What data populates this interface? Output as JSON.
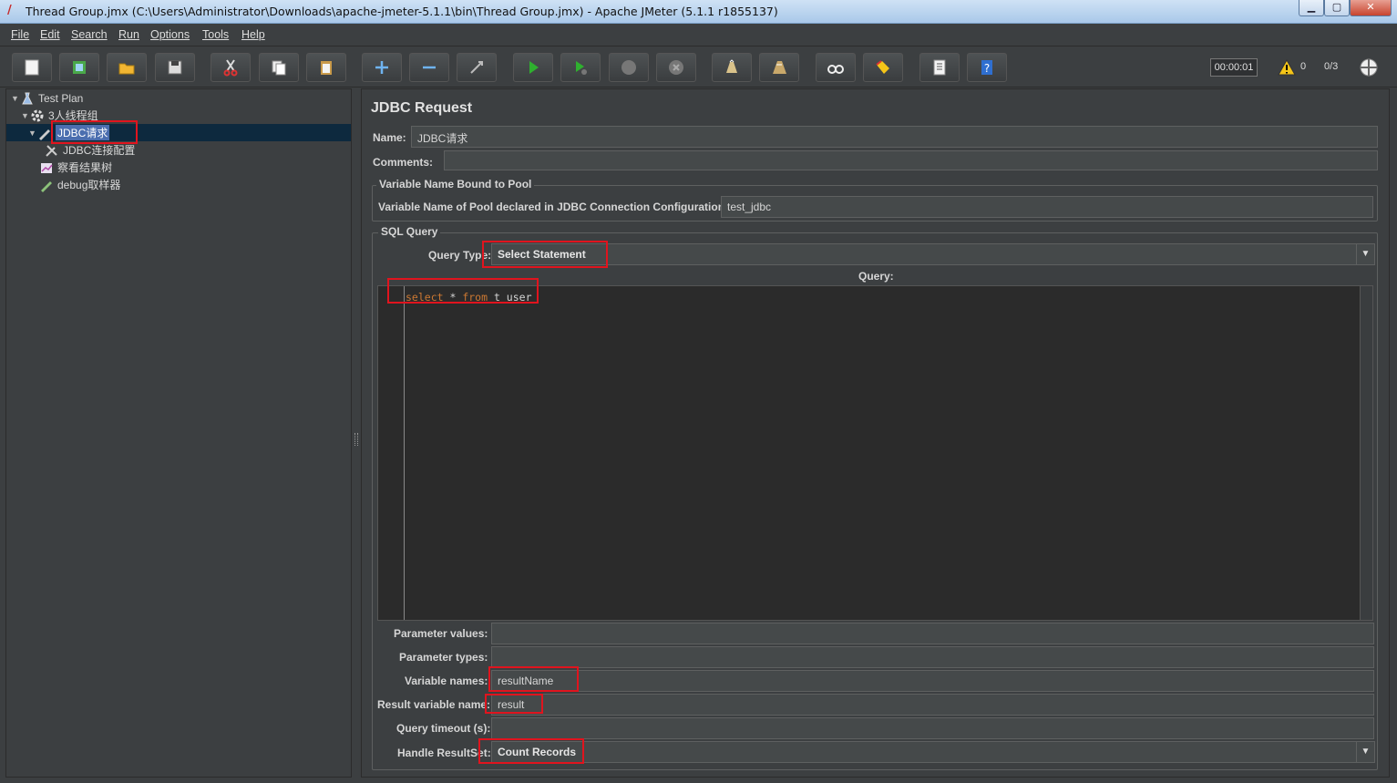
{
  "window": {
    "title": "Thread Group.jmx (C:\\Users\\Administrator\\Downloads\\apache-jmeter-5.1.1\\bin\\Thread Group.jmx) - Apache JMeter (5.1.1 r1855137)",
    "min_label": "▁",
    "max_label": "▢",
    "close_label": "✕"
  },
  "menu": [
    "File",
    "Edit",
    "Search",
    "Run",
    "Options",
    "Tools",
    "Help"
  ],
  "toolbar": {
    "icons": [
      "new-icon",
      "templates-icon",
      "open-icon",
      "save-icon",
      "cut-icon",
      "copy-icon",
      "paste-icon",
      "expand-icon",
      "collapse-icon",
      "toggle-icon",
      "start-icon",
      "start-no-pause-icon",
      "stop-icon",
      "shutdown-icon",
      "clear-icon",
      "clear-all-icon",
      "search-icon",
      "reset-search-icon",
      "function-helper-icon",
      "help-icon"
    ],
    "timer": "00:00:01",
    "warning_count": "0",
    "threads": "0/3"
  },
  "tree": {
    "items": [
      {
        "label": "Test Plan",
        "icon": "test-plan-icon"
      },
      {
        "label": "3人线程组",
        "icon": "thread-group-gear-icon"
      },
      {
        "label": "JDBC请求",
        "icon": "sampler-pencil-icon"
      },
      {
        "label": "JDBC连接配置",
        "icon": "config-wrench-icon"
      },
      {
        "label": "察看结果树",
        "icon": "listener-chart-icon"
      },
      {
        "label": "debug取样器",
        "icon": "sampler-pencil-icon"
      }
    ]
  },
  "panel": {
    "title": "JDBC Request",
    "name_label": "Name:",
    "name_value": "JDBC请求",
    "comments_label": "Comments:",
    "pool_group_title": "Variable Name Bound to Pool",
    "pool_label": "Variable Name of Pool declared in JDBC Connection Configuration:",
    "pool_value": "test_jdbc",
    "sql_group_title": "SQL Query",
    "query_type_label": "Query Type:",
    "query_type_value": "Select Statement",
    "query_label": "Query:",
    "query_kw1": "select",
    "query_mid": " * ",
    "query_kw2": "from",
    "query_tail": " t_user",
    "param_values_label": "Parameter values:",
    "param_values_value": "",
    "param_types_label": "Parameter types:",
    "param_types_value": "",
    "var_names_label": "Variable names:",
    "var_names_value": "resultName",
    "result_var_label": "Result variable name:",
    "result_var_value": "result",
    "timeout_label": "Query timeout (s):",
    "timeout_value": "",
    "handle_label": "Handle ResultSet:",
    "handle_value": "Count Records"
  },
  "colors": {
    "highlight_box": "#e0141e",
    "selection": "#4b6eaf",
    "sql_keyword": "#cc7832"
  }
}
